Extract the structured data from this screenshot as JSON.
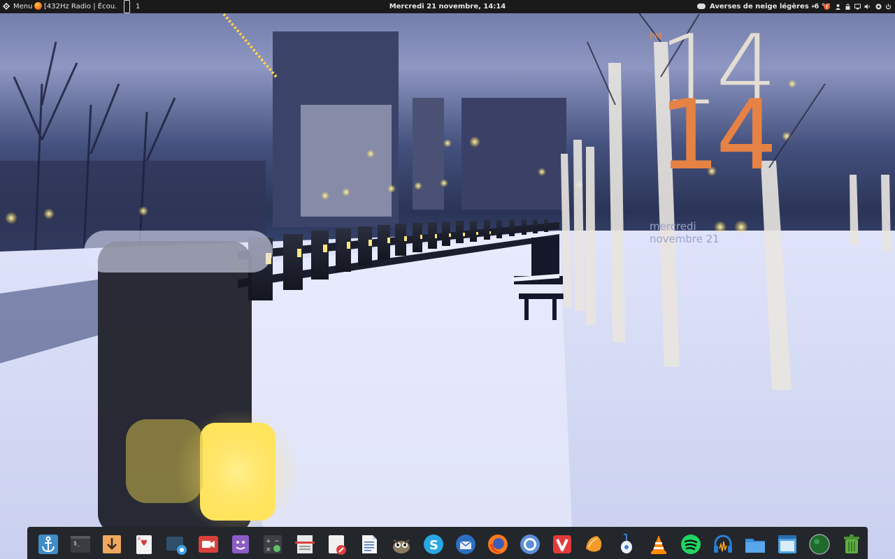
{
  "top_panel": {
    "menu_label": "Menu",
    "window_title": "[432Hz Radio | Écou...",
    "workspace_number": "1",
    "datetime": "Mercredi 21 novembre, 14:14",
    "weather": "Averses de neige légères -6 °C",
    "close_glyph": "×",
    "tray_icons": [
      "alert-icon",
      "user-icon",
      "lock-icon",
      "display-icon",
      "network-icon",
      "volume-icon",
      "power-icon"
    ]
  },
  "desklet": {
    "ampm": "PM",
    "hour": "14",
    "minute": "14",
    "day": "mercredi",
    "date": "novembre 21",
    "colors": {
      "hour": "#e3ddd3",
      "minute": "#e58244",
      "date": "#9aa3c8"
    }
  },
  "dock": {
    "items": [
      "anchor-icon",
      "terminal-icon",
      "download-icon",
      "cards-game-icon",
      "screenshot-icon",
      "video-recorder-icon",
      "purple-face-icon",
      "calculator-icon",
      "document-viewer-icon",
      "editor-icon",
      "text-document-icon",
      "gimp-icon",
      "skype-icon",
      "thunderbird-icon",
      "firefox-icon",
      "chromium-icon",
      "vivaldi-icon",
      "orange-app-icon",
      "blue-mouse-icon",
      "vlc-icon",
      "spotify-icon",
      "audio-app-icon",
      "files-folder-icon",
      "window-app-icon",
      "green-sphere-icon",
      "trash-icon"
    ]
  }
}
